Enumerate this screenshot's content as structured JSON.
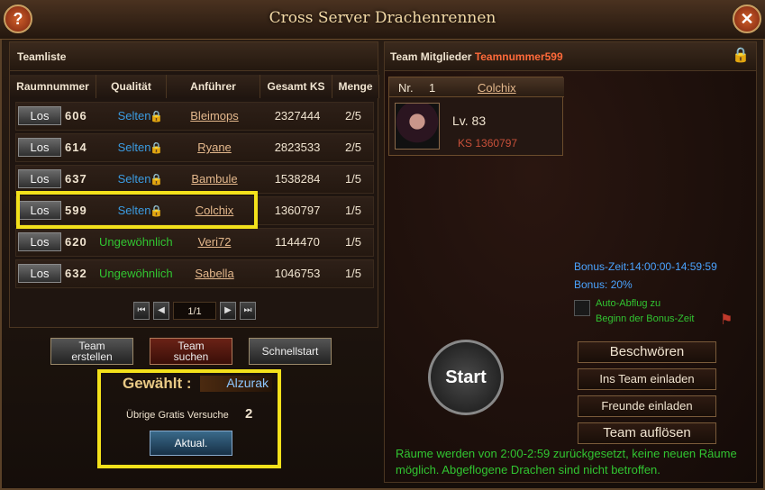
{
  "window": {
    "title": "Cross Server Drachenrennen"
  },
  "left": {
    "header": "Teamliste",
    "columns": [
      "Raumnummer",
      "Qualität",
      "Anführer",
      "Gesamt KS",
      "Menge"
    ],
    "rows": [
      {
        "btn": "Los",
        "room": "606",
        "quality": "Selten",
        "leader": "Bleimops",
        "ks": "2327444",
        "menge": "2/5",
        "qcolor": "#3b9be0"
      },
      {
        "btn": "Los",
        "room": "614",
        "quality": "Selten",
        "leader": "Ryane",
        "ks": "2823533",
        "menge": "2/5",
        "qcolor": "#3b9be0"
      },
      {
        "btn": "Los",
        "room": "637",
        "quality": "Selten",
        "leader": "Bambule",
        "ks": "1538284",
        "menge": "1/5",
        "qcolor": "#3b9be0"
      },
      {
        "btn": "Los",
        "room": "599",
        "quality": "Selten",
        "leader": "Colchix",
        "ks": "1360797",
        "menge": "1/5",
        "qcolor": "#3b9be0"
      },
      {
        "btn": "Los",
        "room": "620",
        "quality": "Ungewöhnlich",
        "leader": "Veri72",
        "ks": "1144470",
        "menge": "1/5",
        "qcolor": "#31c531"
      },
      {
        "btn": "Los",
        "room": "632",
        "quality": "Ungewöhnlich",
        "leader": "Sabella",
        "ks": "1046753",
        "menge": "1/5",
        "qcolor": "#31c531"
      }
    ],
    "pager": {
      "label": "1/1"
    },
    "buttons": {
      "create_1": "Team",
      "create_2": "erstellen",
      "search_1": "Team",
      "search_2": "suchen",
      "quick": "Schnellstart",
      "refresh": "Aktual."
    },
    "chosen_label": "Gewählt :",
    "chosen_value": "Alzurak",
    "attempts_label": "Übrige Gratis Versuche",
    "attempts_count": "2"
  },
  "right": {
    "header": "Team Mitglieder",
    "team_number": "Teamnummer599",
    "member": {
      "nr_label": "Nr.",
      "nr": "1",
      "name": "Colchix",
      "lvl": "Lv. 83",
      "ks": "KS 1360797"
    },
    "bonus_time": "Bonus-Zeit:14:00:00-14:59:59",
    "bonus_val": "Bonus: 20%",
    "auto_1": "Auto-Abflug zu",
    "auto_2": "Beginn der Bonus-Zeit",
    "start": "Start",
    "summon": "Beschwören",
    "invite_team": "Ins Team einladen",
    "invite_friends": "Freunde einladen",
    "dissolve": "Team auflösen",
    "notice": "Räume werden von 2:00-2:59 zurückgesetzt, keine neuen Räume möglich. Abgeflogene Drachen sind nicht betroffen."
  }
}
